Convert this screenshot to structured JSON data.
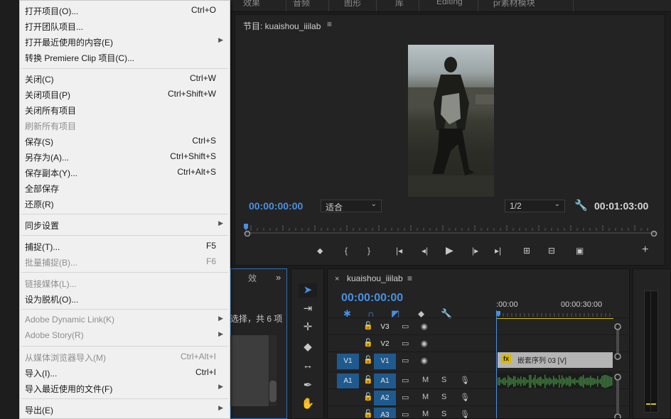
{
  "top_tabs": [
    "效果",
    "音频",
    "图形",
    "库",
    "Editing",
    "pr素材模块"
  ],
  "file_menu": {
    "items": [
      {
        "label": "打开项目(O)...",
        "shortcut": "Ctrl+O",
        "submenu": false,
        "disabled": false
      },
      {
        "label": "打开团队项目...",
        "shortcut": "",
        "submenu": false,
        "disabled": false
      },
      {
        "label": "打开最近使用的内容(E)",
        "shortcut": "",
        "submenu": true,
        "disabled": false
      },
      {
        "label": "转换 Premiere Clip 项目(C)...",
        "shortcut": "",
        "submenu": false,
        "disabled": false
      },
      {
        "label": "关闭(C)",
        "shortcut": "Ctrl+W",
        "submenu": false,
        "disabled": false
      },
      {
        "label": "关闭项目(P)",
        "shortcut": "Ctrl+Shift+W",
        "submenu": false,
        "disabled": false
      },
      {
        "label": "关闭所有项目",
        "shortcut": "",
        "submenu": false,
        "disabled": false
      },
      {
        "label": "刷新所有项目",
        "shortcut": "",
        "submenu": false,
        "disabled": true
      },
      {
        "label": "保存(S)",
        "shortcut": "Ctrl+S",
        "submenu": false,
        "disabled": false
      },
      {
        "label": "另存为(A)...",
        "shortcut": "Ctrl+Shift+S",
        "submenu": false,
        "disabled": false
      },
      {
        "label": "保存副本(Y)...",
        "shortcut": "Ctrl+Alt+S",
        "submenu": false,
        "disabled": false
      },
      {
        "label": "全部保存",
        "shortcut": "",
        "submenu": false,
        "disabled": false
      },
      {
        "label": "还原(R)",
        "shortcut": "",
        "submenu": false,
        "disabled": false
      },
      {
        "label": "同步设置",
        "shortcut": "",
        "submenu": true,
        "disabled": false
      },
      {
        "label": "捕捉(T)...",
        "shortcut": "F5",
        "submenu": false,
        "disabled": false
      },
      {
        "label": "批量捕捉(B)...",
        "shortcut": "F6",
        "submenu": false,
        "disabled": true
      },
      {
        "label": "链接媒体(L)...",
        "shortcut": "",
        "submenu": false,
        "disabled": true
      },
      {
        "label": "设为脱机(O)...",
        "shortcut": "",
        "submenu": false,
        "disabled": false
      },
      {
        "label": "Adobe Dynamic Link(K)",
        "shortcut": "",
        "submenu": true,
        "disabled": true
      },
      {
        "label": "Adobe Story(R)",
        "shortcut": "",
        "submenu": true,
        "disabled": true
      },
      {
        "label": "从媒体浏览器导入(M)",
        "shortcut": "Ctrl+Alt+I",
        "submenu": false,
        "disabled": true
      },
      {
        "label": "导入(I)...",
        "shortcut": "Ctrl+I",
        "submenu": false,
        "disabled": false
      },
      {
        "label": "导入最近使用的文件(F)",
        "shortcut": "",
        "submenu": true,
        "disabled": false
      },
      {
        "label": "导出(E)",
        "shortcut": "",
        "submenu": true,
        "disabled": false
      }
    ]
  },
  "program_monitor": {
    "title": "节目: kuaishou_iiilab",
    "menu_icon": "≡",
    "timecode_current": "00:00:00:00",
    "timecode_duration": "00:01:03:00",
    "fit": "适合",
    "resolution": "1/2"
  },
  "project_bin": {
    "effects_label": "效",
    "more_icon": "»",
    "count_text": "选择，共 6 项"
  },
  "timeline": {
    "name": "kuaishou_iiilab",
    "menu_icon": "≡",
    "close_icon": "×",
    "timecode": "00:00:00:00",
    "ruler_labels": [
      ":00:00",
      "00:00:30:00"
    ],
    "tracks": [
      {
        "name": "V3",
        "source": ""
      },
      {
        "name": "V2",
        "source": ""
      },
      {
        "name": "V1",
        "source": "V1"
      },
      {
        "name": "A1",
        "source": "A1"
      },
      {
        "name": "A2",
        "source": ""
      },
      {
        "name": "A3",
        "source": ""
      }
    ],
    "clip_fx": "fx",
    "clip_name": "嵌套序列 03 [V]",
    "m_label": "M",
    "s_label": "S"
  },
  "colors": {
    "accent_blue": "#4a8fe0",
    "panel_bg": "#232323",
    "menu_bg": "#f0f0f0",
    "audio_green": "#3e7a3e"
  }
}
